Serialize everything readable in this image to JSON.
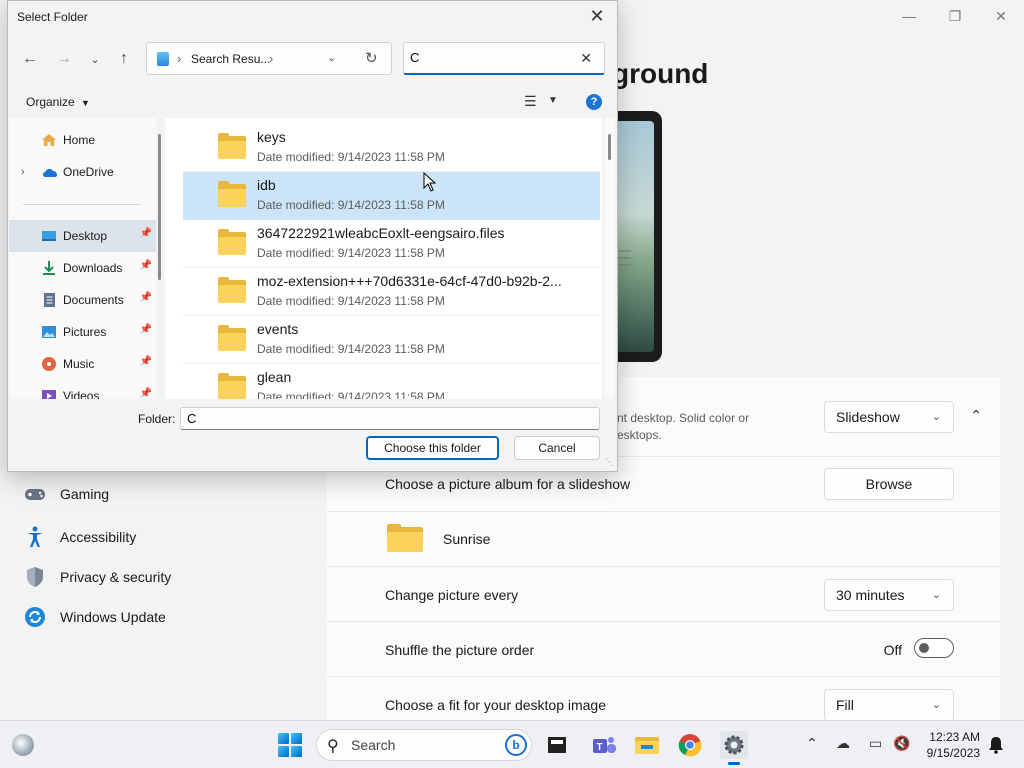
{
  "settings": {
    "title_fragment": "ground",
    "background_desc": {
      "line1": "nt desktop. Solid color or",
      "line2": "esktops."
    },
    "background_type": "Slideshow",
    "album_label": "Choose a picture album for a slideshow",
    "browse_label": "Browse",
    "album_name": "Sunrise",
    "change_every_label": "Change picture every",
    "change_every_value": "30 minutes",
    "shuffle_label": "Shuffle the picture order",
    "shuffle_state": "Off",
    "fit_label": "Choose a fit for your desktop image",
    "fit_value": "Fill"
  },
  "nav": {
    "items": [
      {
        "label": "Gaming",
        "icon": "gamepad-icon"
      },
      {
        "label": "Accessibility",
        "icon": "accessibility-icon"
      },
      {
        "label": "Privacy & security",
        "icon": "shield-icon"
      },
      {
        "label": "Windows Update",
        "icon": "update-icon"
      }
    ]
  },
  "dialog": {
    "title": "Select Folder",
    "address_path": "Search Resu...",
    "search_value": "C",
    "organize_label": "Organize",
    "folder_label": "Folder:",
    "folder_value": "C",
    "choose_label": "Choose this folder",
    "cancel_label": "Cancel",
    "tree": [
      {
        "label": "Home",
        "icon": "home-icon",
        "pinned": false
      },
      {
        "label": "OneDrive",
        "icon": "cloud-icon",
        "pinned": false
      },
      {
        "label": "Desktop",
        "icon": "desktop-icon",
        "pinned": true,
        "selected": true
      },
      {
        "label": "Downloads",
        "icon": "download-icon",
        "pinned": true
      },
      {
        "label": "Documents",
        "icon": "document-icon",
        "pinned": true
      },
      {
        "label": "Pictures",
        "icon": "picture-icon",
        "pinned": true
      },
      {
        "label": "Music",
        "icon": "music-icon",
        "pinned": true
      },
      {
        "label": "Videos",
        "icon": "video-icon",
        "pinned": true
      }
    ],
    "files": [
      {
        "name": "keys",
        "modified": "Date modified: 9/14/2023 11:58 PM"
      },
      {
        "name": "idb",
        "modified": "Date modified: 9/14/2023 11:58 PM",
        "selected": true
      },
      {
        "name": "3647222921wleabcEoxlt-eengsairo.files",
        "modified": "Date modified: 9/14/2023 11:58 PM"
      },
      {
        "name": "moz-extension+++70d6331e-64cf-47d0-b92b-2...",
        "modified": "Date modified: 9/14/2023 11:58 PM"
      },
      {
        "name": "events",
        "modified": "Date modified: 9/14/2023 11:58 PM"
      },
      {
        "name": "glean",
        "modified": "Date modified: 9/14/2023 11:58 PM"
      }
    ]
  },
  "taskbar": {
    "search_label": "Search",
    "time": "12:23 AM",
    "date": "9/15/2023"
  },
  "colors": {
    "accent": "#0067c0",
    "folder": "#fbd25a",
    "selection": "#cce4f7"
  }
}
